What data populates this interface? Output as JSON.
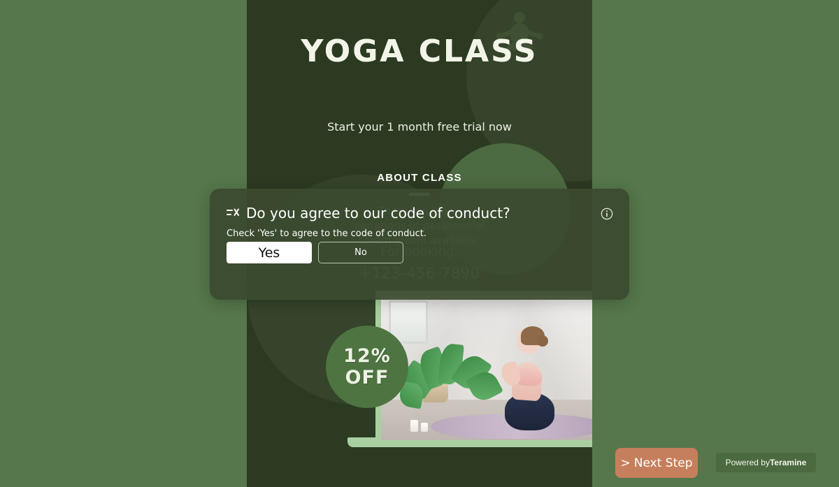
{
  "poster": {
    "title": "YOGA CLASS",
    "subtitle": "Start your 1 month free trial now",
    "about_heading": "ABOUT CLASS",
    "about_body": "There are many variations of passages of Lorem Ipsum available.",
    "booking_label": "For booking:",
    "booking_phone": "+123-456-7890",
    "discount_percent": "12%",
    "discount_label": "OFF",
    "silhouette_icon": "yoga-lotus-pose-icon",
    "photo_alt": "woman-meditating-yoga-photo"
  },
  "modal": {
    "task_icon": "task-checklist-icon",
    "question": "Do you agree to our code of conduct?",
    "hint": "Check 'Yes' to agree to the code of conduct.",
    "yes_label": "Yes",
    "no_label": "No",
    "info_icon": "info-circle-icon"
  },
  "footer": {
    "next_step_label": "Next Step",
    "next_step_chevron": ">",
    "powered_by_prefix": "Powered by",
    "powered_by_brand": "Teramine"
  },
  "colors": {
    "page_background": "#55774b",
    "poster_background": "#2c3a22",
    "poster_circle": "#35442a",
    "about_circle": "#4d6b42",
    "discount_badge": "#4e7442",
    "modal_background": "#3b4a2f",
    "next_step_button": "#c67f5c",
    "powered_badge": "#4b6a3f",
    "laptop_frame": "#a9cfa0",
    "title_text": "#f2f4e8",
    "muted_text": "#9fae96"
  }
}
